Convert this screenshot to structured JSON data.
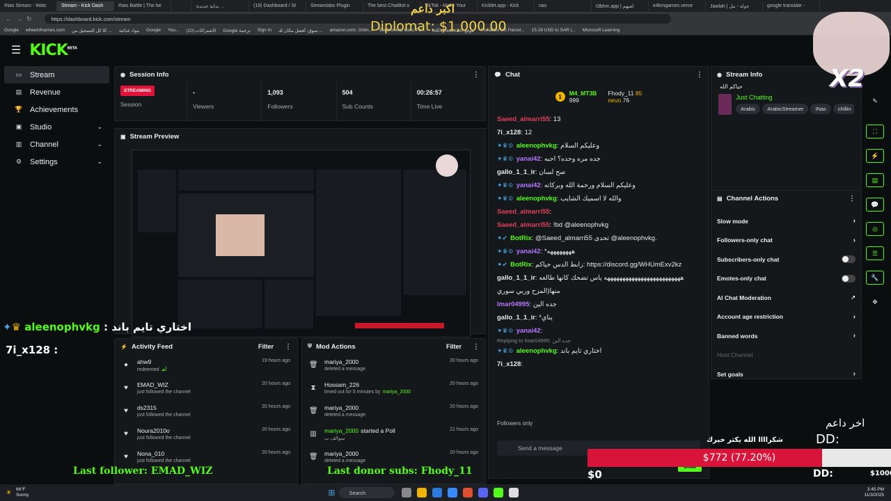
{
  "browser": {
    "tabs": [
      "INas Stream - Watc",
      "Stream - Kick Dash",
      "INas Battle | The be",
      "",
      "بداية جديدة ...",
      "(19) Dashboard / St",
      "Streamlabs Plugin",
      "The best ChatBot o",
      "TikTok - Make Your",
      "Kicklet.app - Kick",
      "nas",
      "t3bhm.app | لعبهم",
      "e4kmgames.verce",
      "Jawlah | جولة - مل",
      "google translate -"
    ],
    "url": "https://dashboard.kick.com/stream",
    "bookmarks": [
      "Google",
      "wheelofnames.com",
      "كل التسجيل من IE ...",
      "مواد غذائية",
      "Google",
      "You...",
      "الاشتراكات (10)",
      "Google ترجمة",
      "Sign In",
      "سوق: أفضل مكان للـ ...",
      "amazon.com: Onlin...",
      "Electronics, Cars, Fa...",
      "AliExpress.com موقع",
      "Fishafast US Parcel...",
      "15.28 USD to SAR |...",
      "Microsoft Learning"
    ]
  },
  "nav": {
    "logo": "KICK",
    "logo_sup": "BETA",
    "items": [
      {
        "label": "Stream",
        "icon": "stream-icon",
        "chev": ""
      },
      {
        "label": "Revenue",
        "icon": "revenue-icon",
        "chev": ""
      },
      {
        "label": "Achievements",
        "icon": "trophy-icon",
        "chev": ""
      },
      {
        "label": "Studio",
        "icon": "studio-icon",
        "chev": "⌄"
      },
      {
        "label": "Channel",
        "icon": "channel-icon",
        "chev": "⌄"
      },
      {
        "label": "Settings",
        "icon": "gear-icon",
        "chev": "⌄"
      }
    ]
  },
  "session": {
    "title": "Session Info",
    "badge": "STREAMING",
    "badge_label": "Session",
    "stats": [
      {
        "value": "-",
        "label": "Viewers"
      },
      {
        "value": "1,093",
        "label": "Followers"
      },
      {
        "value": "504",
        "label": "Sub Counts"
      },
      {
        "value": "00:26:57",
        "label": "Time Live"
      }
    ]
  },
  "preview": {
    "title": "Stream Preview"
  },
  "activity": {
    "title": "Activity Feed",
    "filter": "Filter",
    "rows": [
      {
        "icon": "person-icon",
        "name": "ahw9",
        "sub": "redeemed",
        "extra": "أهـ",
        "time": "19 hours ago"
      },
      {
        "icon": "heart-icon",
        "name": "EMAD_WIZ",
        "sub": "just followed the channel",
        "extra": "",
        "time": "20 hours ago"
      },
      {
        "icon": "heart-icon",
        "name": "ds2315",
        "sub": "just followed the channel",
        "extra": "",
        "time": "20 hours ago"
      },
      {
        "icon": "heart-icon",
        "name": "Noura2010o",
        "sub": "just followed the channel",
        "extra": "",
        "time": "20 hours ago"
      },
      {
        "icon": "heart-icon",
        "name": "Nona_010",
        "sub": "just followed the channel",
        "extra": "",
        "time": "20 hours ago"
      }
    ]
  },
  "mod": {
    "title": "Mod Actions",
    "filter": "Filter",
    "rows": [
      {
        "icon": "trash-icon",
        "name": "mariya_2000",
        "sub": "deleted a message",
        "by": "",
        "time": "20 hours ago"
      },
      {
        "icon": "hourglass-icon",
        "name": "Hossam_226",
        "sub": "timed out for 5 minutes by",
        "by": "mariya_2000",
        "time": "20 hours ago"
      },
      {
        "icon": "trash-icon",
        "name": "mariya_2000",
        "sub": "deleted a message",
        "by": "",
        "time": "20 hours ago"
      },
      {
        "icon": "poll-icon",
        "name": "mariya_2000",
        "sub": "started a Poll",
        "by": "",
        "time": "21 hours ago"
      },
      {
        "icon": "trash-icon",
        "name": "mariya_2000",
        "sub": "deleted a message",
        "by": "",
        "time": "20 hours ago"
      }
    ],
    "poll_text": "سوالف ب"
  },
  "chat": {
    "title": "Chat",
    "pinned": {
      "user1": "M4_MT3B",
      "v1": "999",
      "user2": "Fhody_11",
      "v2": "85",
      "user3": "neuo",
      "v3": "76"
    },
    "messages": [
      {
        "badges": "",
        "user": "Saeed_almarri55",
        "color": "#e0405a",
        "text": "13"
      },
      {
        "badges": "",
        "user": "7i_x128",
        "color": "#e8e8e8",
        "text": "12"
      },
      {
        "badges": "✦♛♔",
        "user": "aleenophvkg",
        "color": "#53fc18",
        "text": "وعليكم السلام"
      },
      {
        "badges": "✦♛♔",
        "user": "yanai42",
        "color": "#b476ff",
        "text": "جده مره وحده؟ احبه"
      },
      {
        "badges": "",
        "user": "gallo_1_1_ir",
        "color": "#e8e8e8",
        "text": "صح لسان"
      },
      {
        "badges": "✦♛♔",
        "user": "yanai42",
        "color": "#b476ff",
        "text": "وعليكم السلام ورحمة الله وبركاته"
      },
      {
        "badges": "✦♛♔",
        "user": "aleenophvkg",
        "color": "#53fc18",
        "text": "والله لا اسميك الشايب"
      },
      {
        "badges": "",
        "user": "Saeed_almarri55",
        "color": "#e0405a",
        "text": ""
      },
      {
        "badges": "",
        "user": "Saeed_almarri55",
        "color": "#e0405a",
        "text": "!bd @aleenophvkg"
      },
      {
        "badges": "✦✔",
        "user": "BotRix",
        "color": "#53fc18",
        "text": "@Saeed_almarri55 تحدى @aleenophvkg."
      },
      {
        "badges": "✦♛♔",
        "user": "yanai42",
        "color": "#b476ff",
        "text": "*ههههههههه"
      },
      {
        "badges": "✦✔",
        "user": "BotRix",
        "color": "#53fc18",
        "text": "رابط الدس حياكم: https://discord.gg/WHUmExv2kz"
      },
      {
        "badges": "",
        "user": "gallo_1_1_ir",
        "color": "#e8e8e8",
        "text": "هههههههههههههههههههههههههه ياس تضحك كانها طالعه"
      },
      {
        "badges": "",
        "user": "",
        "color": "#e8e8e8",
        "text": "منها(المزح وربي سوري"
      },
      {
        "badges": "",
        "user": "lmar04995",
        "color": "#b476ff",
        "text": "جده الين"
      },
      {
        "badges": "",
        "user": "gallo_1_1_ir",
        "color": "#e8e8e8",
        "text": "*يناي"
      },
      {
        "badges": "✦♛♔",
        "user": "yanai42",
        "color": "#b476ff",
        "text": ""
      },
      {
        "badges": "",
        "user": "",
        "color": "#888",
        "text": "Replying to lmar04995: جده الين"
      },
      {
        "badges": "✦♛♔",
        "user": "aleenophvkg",
        "color": "#53fc18",
        "text": "اختاري تايم باند"
      },
      {
        "badges": "",
        "user": "7i_x128",
        "color": "#e8e8e8",
        "text": ""
      }
    ],
    "followers_only": "Followers only",
    "placeholder": "Send a message",
    "send": "Chat"
  },
  "stream_info": {
    "title": "Stream Info",
    "stream_title": "حياكم الله",
    "category": "Just Chatting",
    "tags": [
      "Arabic",
      "ArabicStreamer",
      "INas",
      "chillin"
    ]
  },
  "actions": {
    "title": "Channel Actions",
    "items": [
      {
        "label": "Slow mode",
        "kind": "arrow"
      },
      {
        "label": "Followers-only chat",
        "kind": "arrow"
      },
      {
        "label": "Subscribers-only chat",
        "kind": "toggle"
      },
      {
        "label": "Emotes-only chat",
        "kind": "toggle"
      },
      {
        "label": "AI Chat Moderation",
        "kind": "ext"
      },
      {
        "label": "Account age restriction",
        "kind": "arrow"
      },
      {
        "label": "Banned words",
        "kind": "arrow"
      },
      {
        "label": "Host Channel",
        "kind": "disabled"
      },
      {
        "label": "Set goals",
        "kind": "arrow"
      }
    ]
  },
  "overlays": {
    "top_title": "اكبر داعم",
    "top_amount": "Diplomat: $1,000.00",
    "last_donor": "اخر داعم",
    "last_amount": "DD: $100.00",
    "goal_text": "$772 (77.20%)",
    "goal_progress": 0.772,
    "goal_start": "$0",
    "goal_end": "$1000",
    "dd_label": "DD:",
    "thanks": "شكراااا الله يكثر خيرك",
    "last_follower": "Last follower: EMAD_WIZ",
    "last_sub": "Last donor subs: Fhody_11",
    "x2": "X2",
    "overlay_chat1_user": "aleenophvkg",
    "overlay_chat1_text": "اختاري تايم باند",
    "overlay_chat2_user": "7i_x128"
  },
  "taskbar": {
    "temp": "66°F",
    "weather": "Sunny",
    "search": "Search",
    "time": "3:45 PM",
    "date": "11/3/2025"
  }
}
